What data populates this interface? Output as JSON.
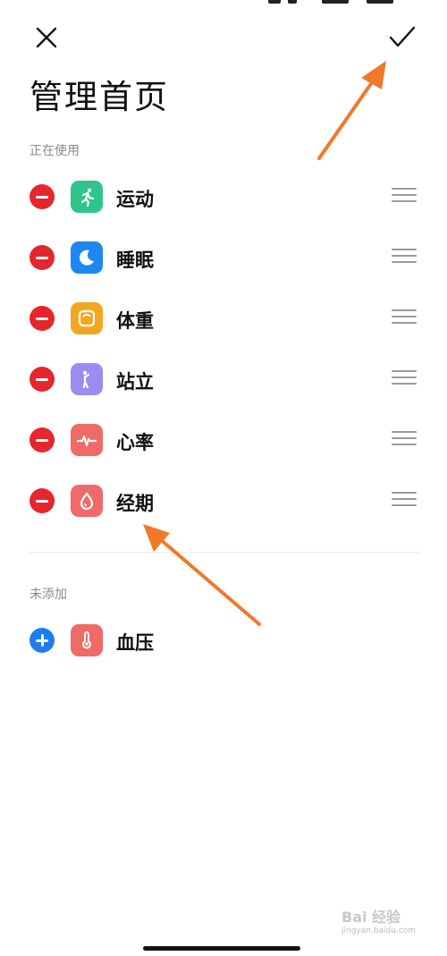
{
  "header": {
    "title": "管理首页",
    "close_icon": "close-icon",
    "confirm_icon": "check-icon"
  },
  "sections": {
    "in_use_label": "正在使用",
    "not_added_label": "未添加"
  },
  "in_use_items": [
    {
      "label": "运动",
      "icon": "running-icon",
      "color": "#2ec48b"
    },
    {
      "label": "睡眠",
      "icon": "moon-icon",
      "color": "#1e88f0"
    },
    {
      "label": "体重",
      "icon": "scale-icon",
      "color": "#f4a623"
    },
    {
      "label": "站立",
      "icon": "standing-icon",
      "color": "#9b8cf2"
    },
    {
      "label": "心率",
      "icon": "heartbeat-icon",
      "color": "#f06a66"
    },
    {
      "label": "经期",
      "icon": "droplet-icon",
      "color": "#f06a6a"
    }
  ],
  "not_added_items": [
    {
      "label": "血压",
      "icon": "thermometer-icon",
      "color": "#f06a66"
    }
  ],
  "watermark": {
    "text": "Bai 经验",
    "sub": "jingyan.baidu.com"
  },
  "colors": {
    "remove": "#e5262d",
    "add": "#1f7cf0",
    "annotation_arrow": "#f07a2a"
  }
}
